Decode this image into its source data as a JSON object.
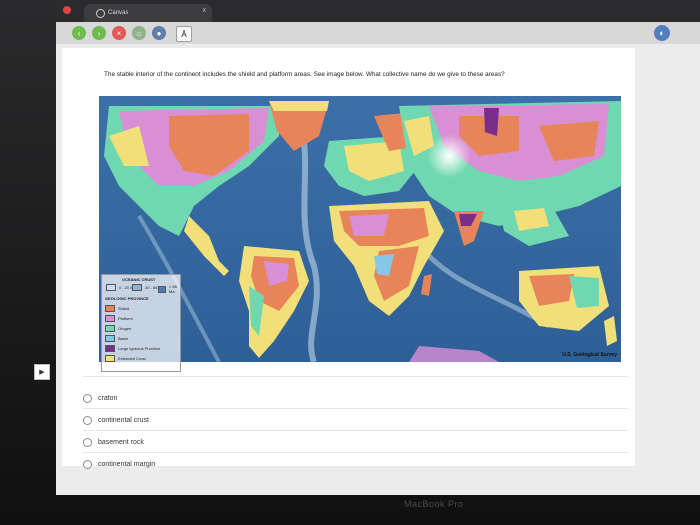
{
  "browser": {
    "tab_title": "Canvas",
    "tab_close": "x",
    "font_button": "Ā"
  },
  "question": {
    "text": "The stable interior of the continent includes the shield and platform areas. See image below. What collective name do we give to these areas?"
  },
  "map": {
    "legend": {
      "oceanic_title": "OCEANIC CRUST",
      "age_labels": [
        "0 - 20 Ma",
        "20 - 65 Ma",
        "> 65 Ma"
      ],
      "province_title": "GEOLOGIC PROVINCE",
      "items": [
        {
          "label": "Shield",
          "color": "#e8845a"
        },
        {
          "label": "Platform",
          "color": "#d98fd4"
        },
        {
          "label": "Orogen",
          "color": "#6fd8b0"
        },
        {
          "label": "Basin",
          "color": "#86c7e8"
        },
        {
          "label": "Large Igneous Province",
          "color": "#7a2e8c"
        },
        {
          "label": "Extended Crust",
          "color": "#f1e07a"
        }
      ]
    },
    "credit": "U.S. Geological Survey"
  },
  "answers": [
    {
      "label": "craton"
    },
    {
      "label": "continental crust"
    },
    {
      "label": "basement rock"
    },
    {
      "label": "continental margin"
    }
  ],
  "device_brand": "MacBook Pro"
}
